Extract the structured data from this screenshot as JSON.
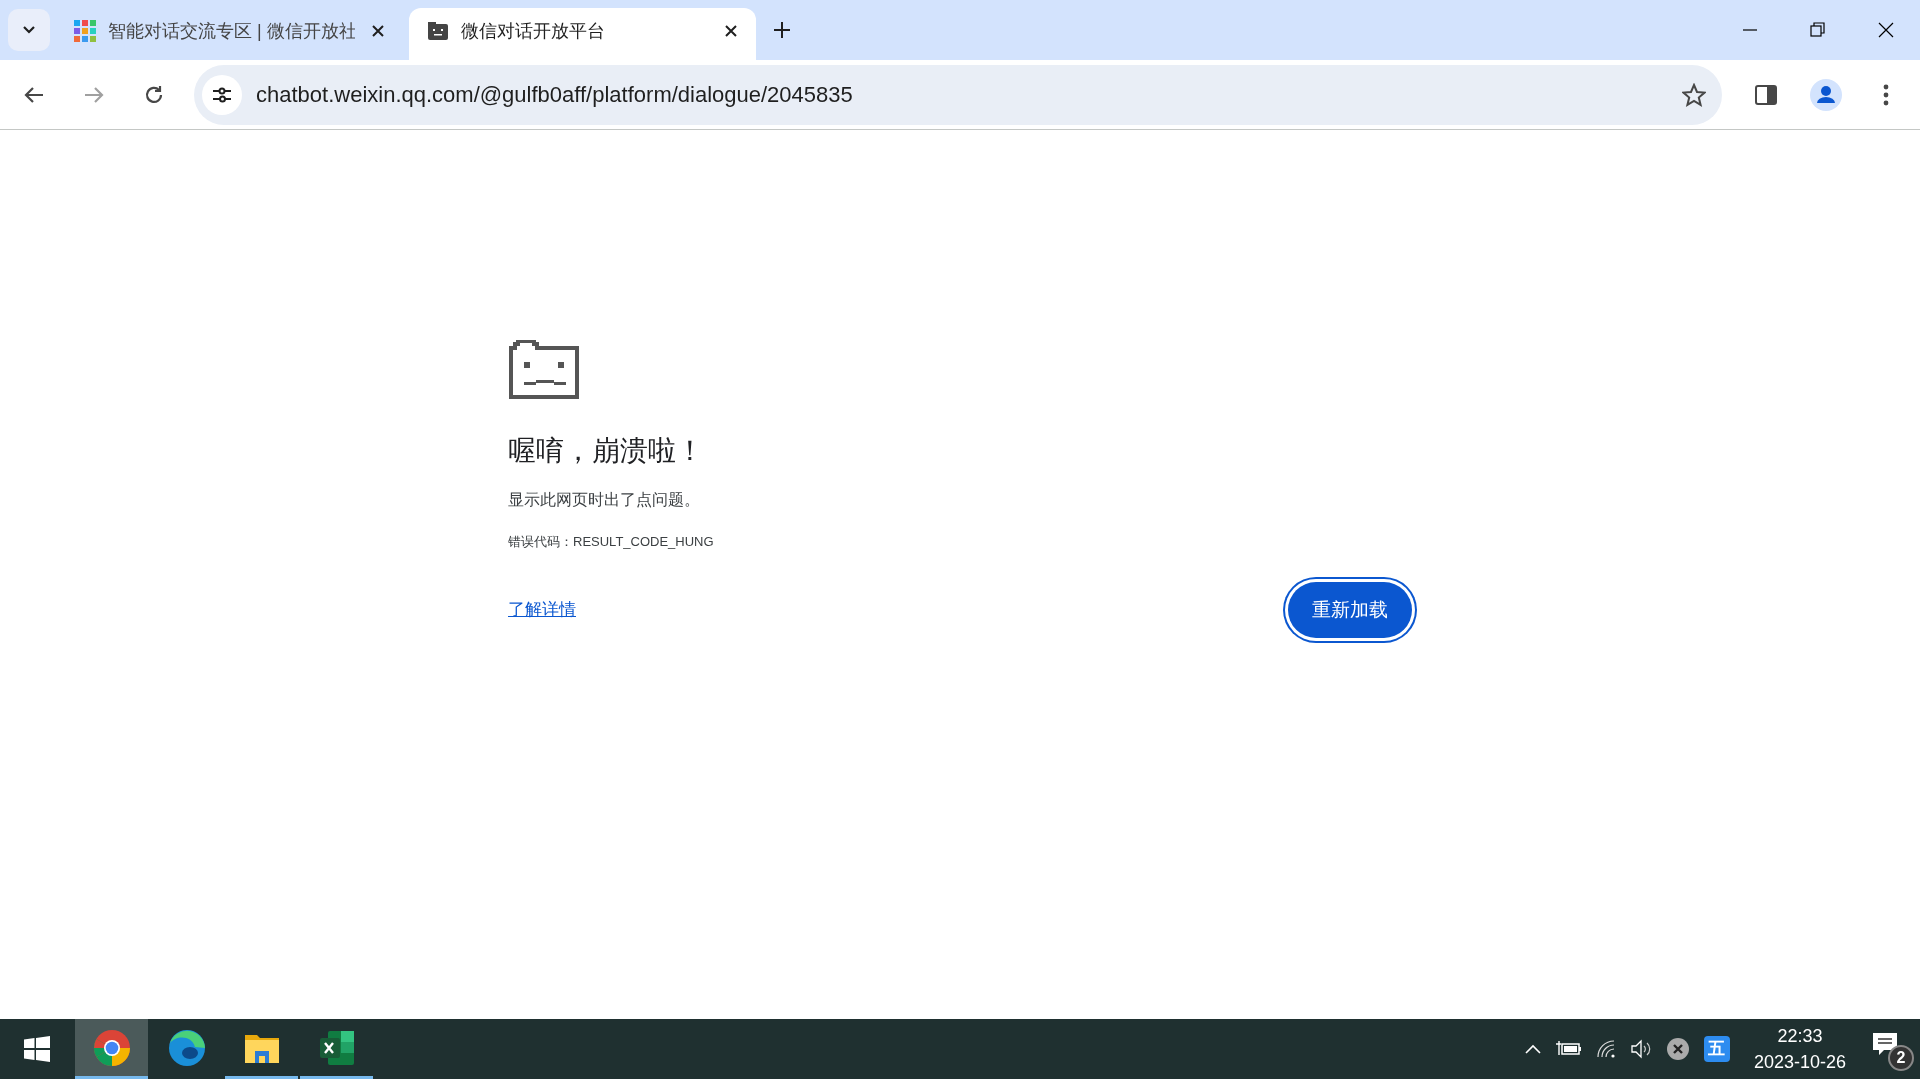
{
  "tabs": [
    {
      "title": "智能对话交流专区 | 微信开放社",
      "selected": false
    },
    {
      "title": "微信对话开放平台",
      "selected": true
    }
  ],
  "toolbar": {
    "back_disabled": false,
    "forward_disabled": true,
    "url": "chatbot.weixin.qq.com/@gulfb0aff/platform/dialogue/2045835"
  },
  "error_page": {
    "heading": "喔唷，崩溃啦！",
    "message": "显示此网页时出了点问题。",
    "error_code": "错误代码：RESULT_CODE_HUNG",
    "link": "了解详情",
    "button": "重新加载"
  },
  "taskbar": {
    "apps": [
      {
        "kind": "chrome",
        "selected": true,
        "running": true
      },
      {
        "kind": "edge",
        "selected": false,
        "running": false
      },
      {
        "kind": "explorer",
        "selected": false,
        "running": true
      },
      {
        "kind": "excel",
        "selected": false,
        "running": true
      }
    ],
    "ime": "五",
    "time": "22:33",
    "date": "2023-10-26",
    "notification_count": "2"
  }
}
